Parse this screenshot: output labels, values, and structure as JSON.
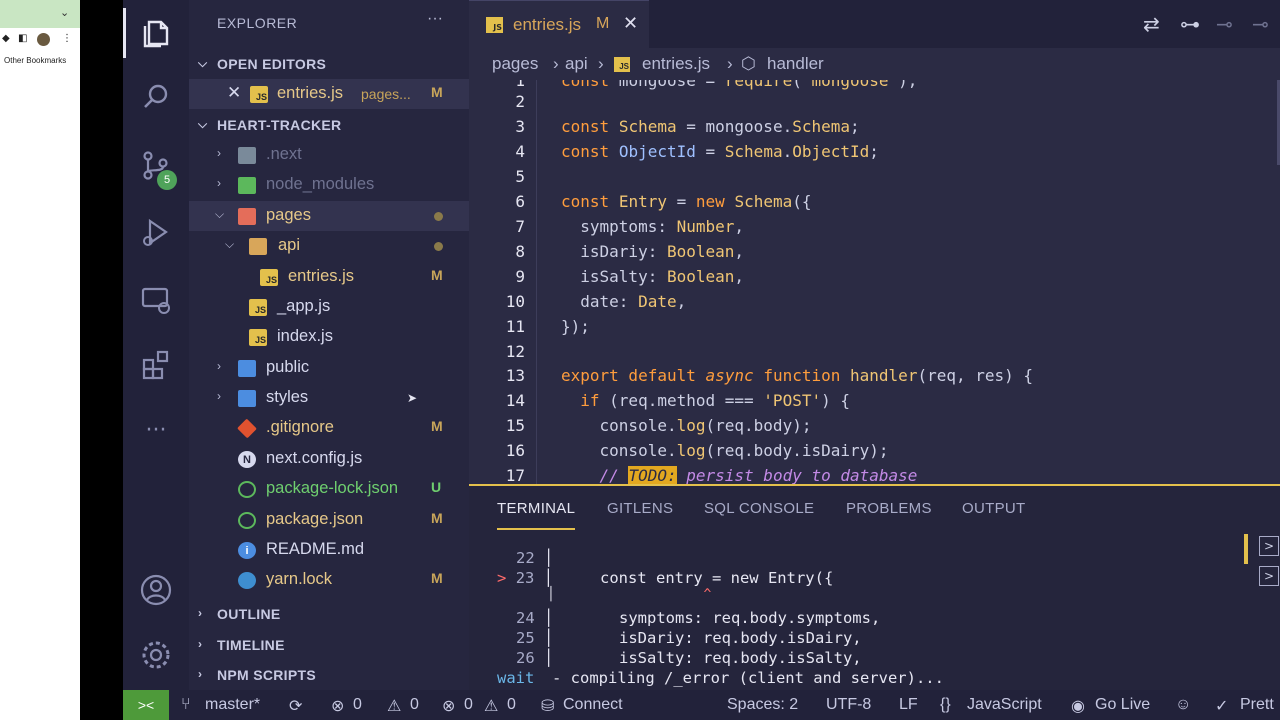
{
  "browser": {
    "bookmarks_label": "Other Bookmarks"
  },
  "activity_bar": {
    "source_control_badge": "5"
  },
  "explorer": {
    "title": "EXPLORER",
    "more": "···",
    "open_editors_label": "OPEN EDITORS",
    "open_editor": {
      "name": "entries.js",
      "path": "pages...",
      "status": "M"
    },
    "project_label": "HEART-TRACKER",
    "tree": [
      {
        "name": ".next",
        "status": ""
      },
      {
        "name": "node_modules",
        "status": ""
      },
      {
        "name": "pages",
        "status": ""
      },
      {
        "name": "api",
        "status": ""
      },
      {
        "name": "entries.js",
        "status": "M"
      },
      {
        "name": "_app.js",
        "status": ""
      },
      {
        "name": "index.js",
        "status": ""
      },
      {
        "name": "public",
        "status": ""
      },
      {
        "name": "styles",
        "status": ""
      },
      {
        "name": ".gitignore",
        "status": "M"
      },
      {
        "name": "next.config.js",
        "status": ""
      },
      {
        "name": "package-lock.json",
        "status": "U"
      },
      {
        "name": "package.json",
        "status": "M"
      },
      {
        "name": "README.md",
        "status": ""
      },
      {
        "name": "yarn.lock",
        "status": "M"
      }
    ],
    "outline_label": "OUTLINE",
    "timeline_label": "TIMELINE",
    "npm_scripts_label": "NPM SCRIPTS"
  },
  "tab": {
    "name": "entries.js",
    "status": "M"
  },
  "breadcrumb": {
    "seg1": "pages",
    "seg2": "api",
    "seg3": "entries.js",
    "seg4": "handler"
  },
  "editor": {
    "line_numbers": [
      "1",
      "2",
      "3",
      "4",
      "5",
      "6",
      "7",
      "8",
      "9",
      "10",
      "11",
      "12",
      "13",
      "14",
      "15",
      "16",
      "17"
    ]
  },
  "panel": {
    "tabs": [
      "TERMINAL",
      "GITLENS",
      "SQL CONSOLE",
      "PROBLEMS",
      "OUTPUT"
    ],
    "lines": {
      "n22": "22",
      "n23": "23",
      "l23": "const entry = new Entry({",
      "n24": "24",
      "l24": "symptoms: req.body.symptoms,",
      "n25": "25",
      "l25": "isDariy: req.body.isDairy,",
      "n26": "26",
      "l26": "isSalty: req.body.isSalty,",
      "wait": "wait",
      "wait_msg": "- compiling /_error (client and server)..."
    }
  },
  "status_bar": {
    "branch": "master*",
    "errors": "0",
    "warnings": "0",
    "info_a": "0",
    "info_b": "0",
    "connect": "Connect",
    "spaces": "Spaces: 2",
    "encoding": "UTF-8",
    "eol": "LF",
    "language": "JavaScript",
    "go_live": "Go Live",
    "prettier": "Prett"
  },
  "colors": {
    "accent": "#e3c04c",
    "modified": "#c8a55a",
    "remote": "#4e9a3a",
    "background": "#2b2b44"
  }
}
